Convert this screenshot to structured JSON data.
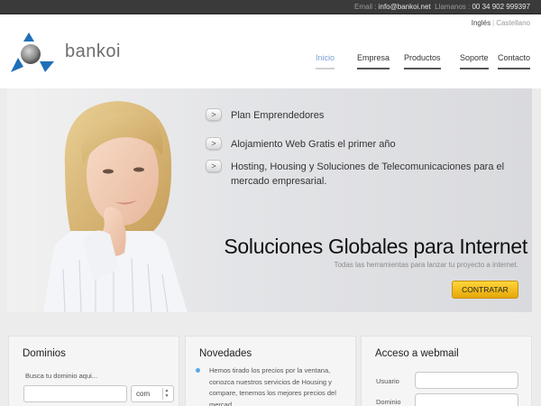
{
  "topbar": {
    "email_label": "Email :",
    "email_value": "info@bankoi.net",
    "phone_label": "Llamanos :",
    "phone_value": "00 34 902 999397"
  },
  "languages": {
    "active": "Inglés",
    "other": "Castellano"
  },
  "brand": {
    "name": "bankoi",
    "colors": {
      "blue": "#1f6fb8",
      "gray": "#6d6d6d"
    }
  },
  "nav": [
    {
      "label": "Inicio",
      "active": true
    },
    {
      "label": "Empresa",
      "active": false
    },
    {
      "label": "Productos",
      "active": false
    },
    {
      "label": "Soporte",
      "active": false
    },
    {
      "label": "Contacto",
      "active": false
    }
  ],
  "hero": {
    "bullets": [
      "Plan Emprendedores",
      "Alojamiento Web Gratis el primer año",
      "Hosting, Housing y Soluciones de Telecomunicaciones para el mercado empresarial."
    ],
    "title": "Soluciones Globales para Internet",
    "subtitle": "Todas las herramientas para lanzar tu proyecto a internet.",
    "cta": "CONTRATAR",
    "cta_color": "#f2bd1f"
  },
  "dominios": {
    "title": "Dominios",
    "label": "Busca tu dominio aqui...",
    "input_value": "",
    "tld_selected": "com"
  },
  "novedades": {
    "title": "Novedades",
    "item": "Hemos tirado los precios por la ventana, conozca nuestros servicios de Housing y compare, tenemos los mejores precios del mercad"
  },
  "webmail": {
    "title": "Acceso a webmail",
    "user_label": "Usuario",
    "domain_label": "Dominio",
    "user_value": "",
    "domain_value": ""
  }
}
